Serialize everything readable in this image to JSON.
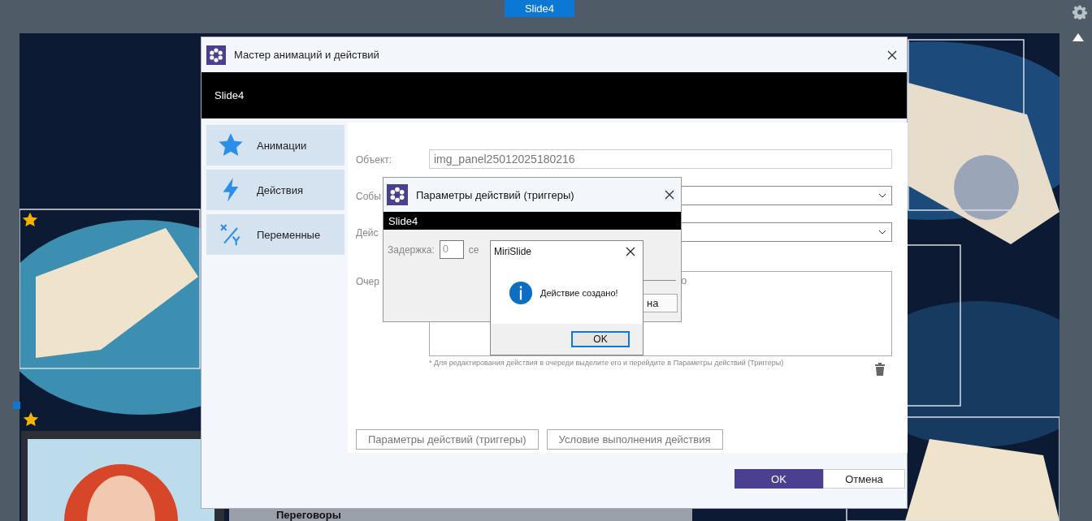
{
  "top_tab": {
    "label": "Slide4",
    "selected": true
  },
  "slide": {
    "caption": "Переговоры"
  },
  "wizard": {
    "title": "Мастер анимаций и действий",
    "band": "Slide4",
    "nav": [
      {
        "label": "Анимации"
      },
      {
        "label": "Действия"
      },
      {
        "label": "Переменные"
      }
    ],
    "object_label": "Объект:",
    "object_value": "img_panel25012025180216",
    "event_label": "Собы",
    "action_label": "Дейс",
    "queue_label": "Очер",
    "queue_text": "о",
    "note": "* Для редактирования действия в очереди выделите его и перейдите в Параметры действий (Триггеры)",
    "buttons": [
      "Параметры действий (триггеры)",
      "Условие выполнения действия"
    ],
    "ok": "OK",
    "cancel": "Отмена"
  },
  "triggers": {
    "title": "Параметры действий (триггеры)",
    "band": "Slide4",
    "delay_label": "Задержка:",
    "delay_value": "0",
    "unit": "се",
    "button_fragment": "на"
  },
  "message": {
    "title": "MiriSlide",
    "text": "Действие создано!",
    "ok": "OK"
  }
}
